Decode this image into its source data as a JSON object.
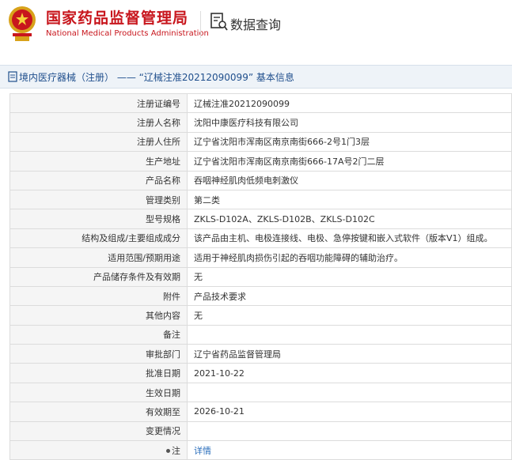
{
  "header": {
    "brand_cn": "国家药品监督管理局",
    "brand_en": "National Medical Products Administration",
    "query_title": "数据查询",
    "accent": "#c8161d"
  },
  "bar": {
    "text": "境内医疗器械（注册） —— “辽械注准20212090099” 基本信息",
    "icon": "document-icon"
  },
  "rows": [
    {
      "label": "注册证编号",
      "value": "辽械注准20212090099"
    },
    {
      "label": "注册人名称",
      "value": "沈阳中康医疗科技有限公司"
    },
    {
      "label": "注册人住所",
      "value": "辽宁省沈阳市浑南区南京南街666-2号1门3层"
    },
    {
      "label": "生产地址",
      "value": "辽宁省沈阳市浑南区南京南街666-17A号2门二层"
    },
    {
      "label": "产品名称",
      "value": "吞咽神经肌肉低频电刺激仪"
    },
    {
      "label": "管理类别",
      "value": "第二类"
    },
    {
      "label": "型号规格",
      "value": "ZKLS-D102A、ZKLS-D102B、ZKLS-D102C"
    },
    {
      "label": "结构及组成/主要组成成分",
      "value": "该产品由主机、电极连接线、电极、急停按键和嵌入式软件（版本V1）组成。"
    },
    {
      "label": "适用范围/预期用途",
      "value": "适用于神经肌肉损伤引起的吞咽功能障碍的辅助治疗。"
    },
    {
      "label": "产品储存条件及有效期",
      "value": "无"
    },
    {
      "label": "附件",
      "value": "产品技术要求"
    },
    {
      "label": "其他内容",
      "value": "无"
    },
    {
      "label": "备注",
      "value": ""
    },
    {
      "label": "审批部门",
      "value": "辽宁省药品监督管理局"
    },
    {
      "label": "批准日期",
      "value": "2021-10-22"
    },
    {
      "label": "生效日期",
      "value": ""
    },
    {
      "label": "有效期至",
      "value": "2026-10-21"
    },
    {
      "label": "变更情况",
      "value": ""
    },
    {
      "label": "注",
      "value": "详情"
    }
  ]
}
